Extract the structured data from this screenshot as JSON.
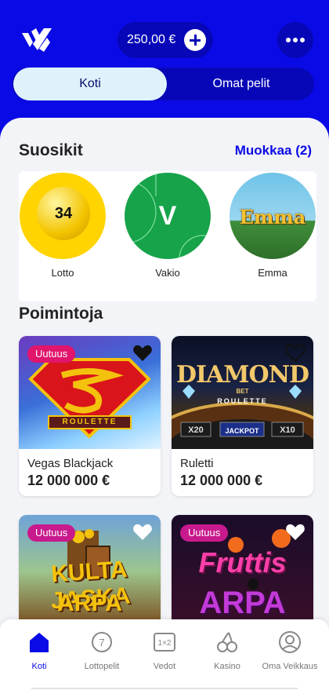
{
  "header": {
    "balance": "250,00 €",
    "logo_icon": "veikkaus-logo-icon",
    "add_icon": "plus-icon",
    "more_icon": "more-dots-icon"
  },
  "tabs": [
    {
      "label": "Koti",
      "active": true
    },
    {
      "label": "Omat pelit",
      "active": false
    }
  ],
  "favorites": {
    "title": "Suosikit",
    "edit_label": "Muokkaa (2)",
    "items": [
      {
        "label": "Lotto",
        "art_text": "34"
      },
      {
        "label": "Vakio",
        "art_text": "V"
      },
      {
        "label": "Emma",
        "art_text": "Emma"
      }
    ]
  },
  "picks": {
    "title": "Poimintoja",
    "cards": [
      {
        "name": "Vegas Blackjack",
        "prize": "12 000 000 €",
        "badge": "Uutuus",
        "favorited": true,
        "art_lines": [
          "ROULETTE"
        ]
      },
      {
        "name": "Ruletti",
        "prize": "12 000 000 €",
        "badge": "",
        "favorited": false,
        "art_lines": [
          "DIAMOND",
          "BET",
          "ROULETTE",
          "X20",
          "JACKPOT",
          "X10"
        ]
      },
      {
        "name": "",
        "prize": "",
        "badge": "Uutuus",
        "favorited": false,
        "art_lines": [
          "KULTA",
          "JASKA",
          "ARPA"
        ]
      },
      {
        "name": "",
        "prize": "",
        "badge": "Uutuus",
        "favorited": false,
        "art_lines": [
          "Fruttis",
          "ARPA"
        ]
      }
    ]
  },
  "bottom_nav": [
    {
      "label": "Koti",
      "icon": "home-icon",
      "active": true
    },
    {
      "label": "Lottopelit",
      "icon": "lotto-ball-icon",
      "active": false
    },
    {
      "label": "Vedot",
      "icon": "betting-slip-icon",
      "active": false
    },
    {
      "label": "Kasino",
      "icon": "cherries-icon",
      "active": false
    },
    {
      "label": "Oma Veikkaus",
      "icon": "user-icon",
      "active": false
    }
  ],
  "colors": {
    "brand_blue": "#0a0ae6",
    "badge_pink": "#e0156b",
    "tab_active_bg": "#dff1fb"
  }
}
